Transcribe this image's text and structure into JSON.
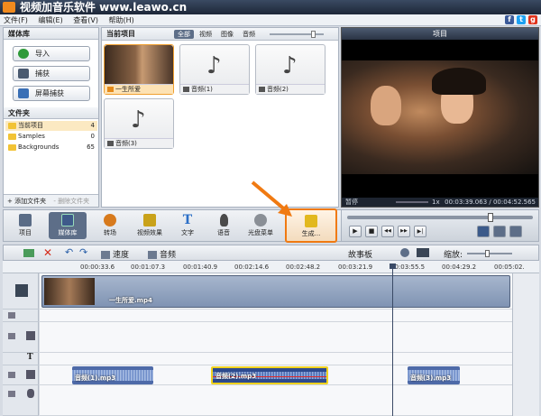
{
  "window": {
    "title": "视频加音乐软件 www.leawo.cn"
  },
  "menu": [
    "文件(F)",
    "编辑(E)",
    "查看(V)",
    "帮助(H)"
  ],
  "social_icons": [
    {
      "glyph": "f",
      "color": "#3b5998",
      "name": "facebook-icon"
    },
    {
      "glyph": "t",
      "color": "#1da1f2",
      "name": "twitter-icon"
    },
    {
      "glyph": "g",
      "color": "#e0321c",
      "name": "google-icon"
    }
  ],
  "library": {
    "title": "媒体库",
    "buttons": [
      {
        "label": "导入",
        "color": "#2f9a3a"
      },
      {
        "label": "捕获",
        "color": "#4a5a70"
      },
      {
        "label": "屏幕捕获",
        "color": "#3a6fb5"
      }
    ],
    "folders_title": "文件夹",
    "folders": [
      {
        "name": "当前项目",
        "count": "4"
      },
      {
        "name": "Samples",
        "count": "0"
      },
      {
        "name": "Backgrounds",
        "count": "65"
      }
    ],
    "add_folder": "+ 添加文件夹",
    "remove_folder": "- 删除文件夹"
  },
  "project": {
    "title": "当前项目",
    "filters": [
      "全部",
      "视频",
      "图像",
      "音频"
    ],
    "items": [
      {
        "kind": "video",
        "name": "一生所爱"
      },
      {
        "kind": "audio",
        "name": "音频(1)"
      },
      {
        "kind": "audio",
        "name": "音频(2)"
      },
      {
        "kind": "audio",
        "name": "音频(3)"
      }
    ]
  },
  "preview": {
    "title": "项目",
    "status": "暂停",
    "speed": "1x",
    "time": "00:03:39.063 / 00:04:52.565"
  },
  "toolbar": {
    "buttons": [
      {
        "label": "项目",
        "name": "project-button",
        "color": "#5a6c86"
      },
      {
        "label": "媒体库",
        "name": "media-library-button",
        "color": "#3e5a8a"
      },
      {
        "label": "转场",
        "name": "transitions-button",
        "color": "#d77a1d"
      },
      {
        "label": "视频效果",
        "name": "video-effects-button",
        "color": "#c9a21a"
      },
      {
        "label": "文字",
        "name": "text-button",
        "color": "#2b6fc7"
      },
      {
        "label": "语音",
        "name": "voice-button",
        "color": "#4a4a4a"
      },
      {
        "label": "光盘菜单",
        "name": "disc-menu-button",
        "color": "#8a8f96"
      },
      {
        "label": "生成...",
        "name": "produce-button",
        "color": "#e2b81e"
      }
    ],
    "highlight_color": "#f07a12"
  },
  "controls": {
    "symbols": [
      "▶",
      "■",
      "◀◀",
      "▶▶",
      "▶|"
    ]
  },
  "timeline": {
    "tools": {
      "speed": "速度",
      "audio": "音频",
      "storyboard": "故事板",
      "zoom": "缩放:"
    },
    "ruler": [
      "00:00:33.6",
      "00:01:07.3",
      "00:01:40.9",
      "00:02:14.6",
      "00:02:48.2",
      "00:03:21.9",
      "00:03:55.5",
      "00:04:29.2",
      "00:05:02."
    ],
    "video_clip": "一生所爱.mp4",
    "audio_clips": [
      "音频(1).mp3",
      "音频(2).mp3",
      "音频(3).mp3"
    ]
  }
}
